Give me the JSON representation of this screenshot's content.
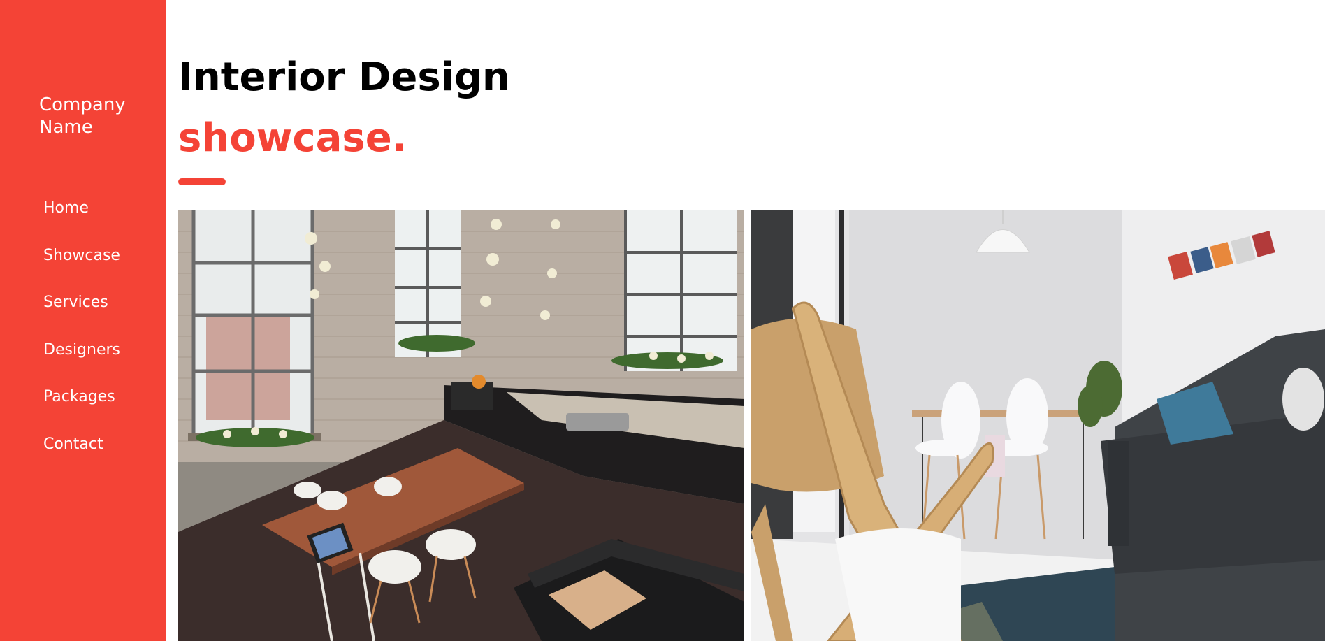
{
  "sidebar": {
    "brand": "Company Name",
    "nav": [
      {
        "label": "Home"
      },
      {
        "label": "Showcase"
      },
      {
        "label": "Services"
      },
      {
        "label": "Designers"
      },
      {
        "label": "Packages"
      },
      {
        "label": "Contact"
      }
    ]
  },
  "header": {
    "title": "Interior Design",
    "subtitle": "showcase."
  },
  "colors": {
    "accent": "#f44336",
    "sidebar_text": "#ffffff",
    "title": "#000000"
  }
}
